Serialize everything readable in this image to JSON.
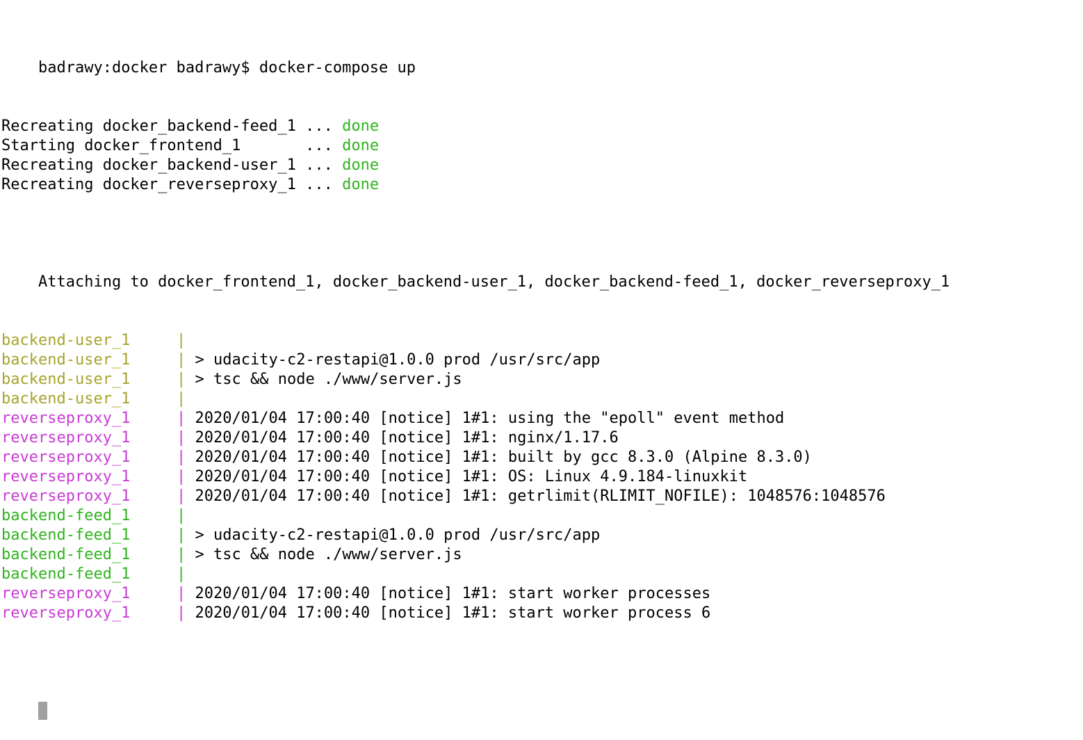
{
  "colors": {
    "text": "#000000",
    "done": "#2fb41d",
    "backend_user": "#a6a42c",
    "reverseproxy": "#c83cd4",
    "backend_feed": "#2fb41d",
    "cursor": "#a0a0a0"
  },
  "prompt": {
    "text": "badrawy:docker badrawy$ docker-compose up"
  },
  "status_lines": [
    {
      "text": "Recreating docker_backend-feed_1 ... ",
      "status": "done"
    },
    {
      "text": "Starting docker_frontend_1       ... ",
      "status": "done"
    },
    {
      "text": "Recreating docker_backend-user_1 ... ",
      "status": "done"
    },
    {
      "text": "Recreating docker_reverseproxy_1 ... ",
      "status": "done"
    }
  ],
  "attach_line": "Attaching to docker_frontend_1, docker_backend-user_1, docker_backend-feed_1, docker_reverseproxy_1",
  "log_lines": [
    {
      "service": "backend-user_1",
      "kind": "backend_user",
      "sep": "|",
      "message": ""
    },
    {
      "service": "backend-user_1",
      "kind": "backend_user",
      "sep": "|",
      "message": "> udacity-c2-restapi@1.0.0 prod /usr/src/app"
    },
    {
      "service": "backend-user_1",
      "kind": "backend_user",
      "sep": "|",
      "message": "> tsc && node ./www/server.js"
    },
    {
      "service": "backend-user_1",
      "kind": "backend_user",
      "sep": "|",
      "message": ""
    },
    {
      "service": "reverseproxy_1",
      "kind": "reverseproxy",
      "sep": "|",
      "message": "2020/01/04 17:00:40 [notice] 1#1: using the \"epoll\" event method"
    },
    {
      "service": "reverseproxy_1",
      "kind": "reverseproxy",
      "sep": "|",
      "message": "2020/01/04 17:00:40 [notice] 1#1: nginx/1.17.6"
    },
    {
      "service": "reverseproxy_1",
      "kind": "reverseproxy",
      "sep": "|",
      "message": "2020/01/04 17:00:40 [notice] 1#1: built by gcc 8.3.0 (Alpine 8.3.0)"
    },
    {
      "service": "reverseproxy_1",
      "kind": "reverseproxy",
      "sep": "|",
      "message": "2020/01/04 17:00:40 [notice] 1#1: OS: Linux 4.9.184-linuxkit"
    },
    {
      "service": "reverseproxy_1",
      "kind": "reverseproxy",
      "sep": "|",
      "message": "2020/01/04 17:00:40 [notice] 1#1: getrlimit(RLIMIT_NOFILE): 1048576:1048576"
    },
    {
      "service": "backend-feed_1",
      "kind": "backend_feed",
      "sep": "|",
      "message": ""
    },
    {
      "service": "backend-feed_1",
      "kind": "backend_feed",
      "sep": "|",
      "message": "> udacity-c2-restapi@1.0.0 prod /usr/src/app"
    },
    {
      "service": "backend-feed_1",
      "kind": "backend_feed",
      "sep": "|",
      "message": "> tsc && node ./www/server.js"
    },
    {
      "service": "backend-feed_1",
      "kind": "backend_feed",
      "sep": "|",
      "message": ""
    },
    {
      "service": "reverseproxy_1",
      "kind": "reverseproxy",
      "sep": "|",
      "message": "2020/01/04 17:00:40 [notice] 1#1: start worker processes"
    },
    {
      "service": "reverseproxy_1",
      "kind": "reverseproxy",
      "sep": "|",
      "message": "2020/01/04 17:00:40 [notice] 1#1: start worker process 6"
    }
  ]
}
